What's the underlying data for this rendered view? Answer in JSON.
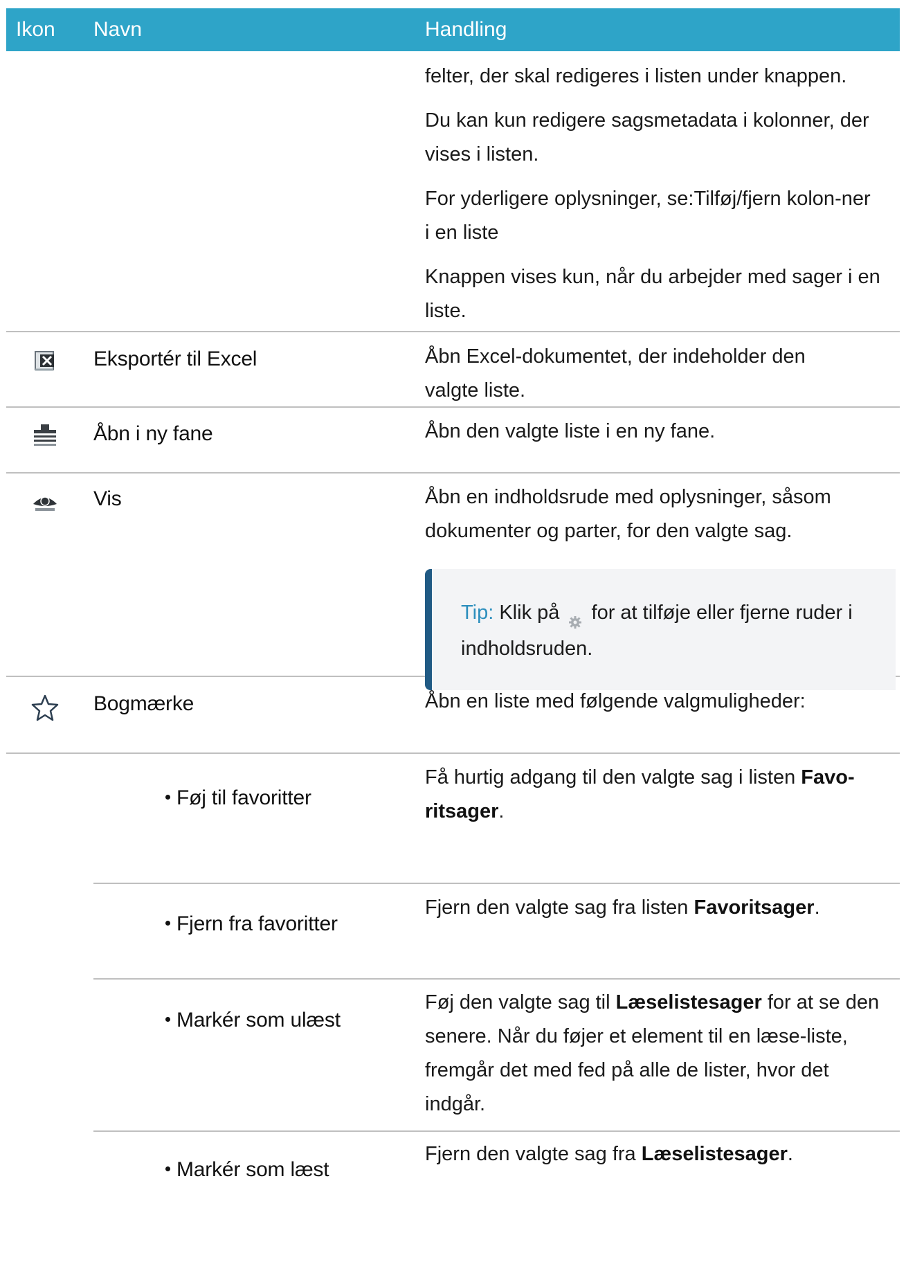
{
  "header": {
    "icon_col": "Ikon",
    "name_col": "Navn",
    "action_col": "Handling"
  },
  "rows": [
    {
      "name": "",
      "action": [
        "felter, der skal redigeres i listen under knappen.",
        "Du kan kun redigere sagsmetadata i kolonner, der vises i listen.",
        "For yderligere oplysninger, se:Tilføj/fjern kolon-ner i en liste",
        "Knappen vises kun, når du arbejder med sager i en liste."
      ]
    },
    {
      "icon": "excel-export-icon",
      "name": "Eksportér til Excel",
      "action": "Åbn Excel-dokumentet, der indeholder den valgte liste."
    },
    {
      "icon": "new-tab-icon",
      "name": "Åbn i ny fane",
      "action": "Åbn den valgte liste i en ny fane."
    },
    {
      "icon": "eye-icon",
      "name": "Vis",
      "action": "Åbn en indholdsrude med oplysninger, såsom dokumenter og parter, for den valgte sag.",
      "tip": {
        "label": "Tip:",
        "text_before": "Klik på",
        "icon": "gear-icon",
        "text_after": "for at tilføje eller fjerne ruder i indholdsruden."
      }
    },
    {
      "icon": "star-outline-icon",
      "name": "Bogmærke",
      "action": "Åbn en liste med følgende valgmuligheder:"
    }
  ],
  "sub_rows": [
    {
      "name": "Føj til favoritter",
      "action_parts": [
        "Få hurtig adgang til den valgte sag i listen ",
        "Favo-ritsager",
        "."
      ]
    },
    {
      "name": "Fjern fra favoritter",
      "action_parts": [
        "Fjern den valgte sag fra listen ",
        "Favoritsager",
        "."
      ]
    },
    {
      "name": "Markér som ulæst",
      "action_parts": [
        "Føj den valgte sag til ",
        "Læselistesager",
        " for at se den senere. Når du føjer et element til en læse-liste, fremgår det med fed på alle de lister, hvor det indgår."
      ]
    },
    {
      "name": "Markér som læst",
      "action_parts": [
        "Fjern den valgte sag fra ",
        "Læselistesager",
        "."
      ]
    }
  ],
  "colors": {
    "header_bg": "#2ea4c8",
    "tip_bar": "#205a84",
    "tip_label": "#2d8fbd",
    "tip_bg": "#f3f4f6"
  }
}
